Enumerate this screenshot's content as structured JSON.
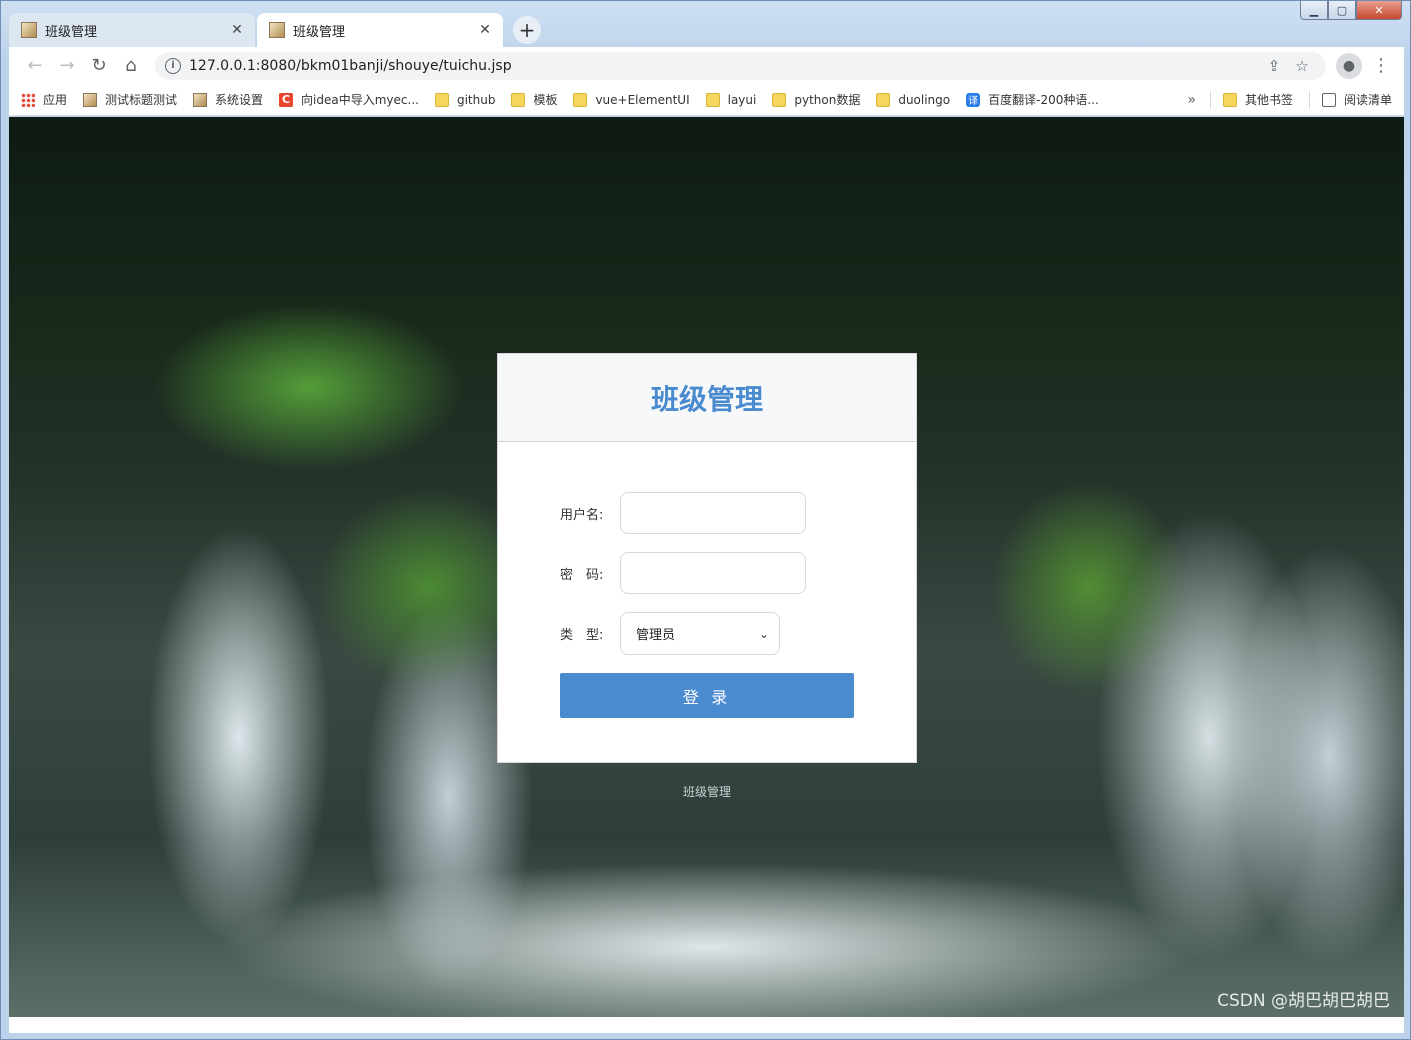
{
  "tabs": [
    {
      "title": "班级管理",
      "active": false
    },
    {
      "title": "班级管理",
      "active": true
    }
  ],
  "toolbar": {
    "url": "127.0.0.1:8080/bkm01banji/shouye/tuichu.jsp"
  },
  "bookmarks": [
    {
      "label": "应用",
      "icon": "apps-grid-icon"
    },
    {
      "label": "测试标题测试",
      "icon": "page-icon"
    },
    {
      "label": "系统设置",
      "icon": "page-icon"
    },
    {
      "label": "向idea中导入myec...",
      "icon": "csdn-icon"
    },
    {
      "label": "github",
      "icon": "folder-icon"
    },
    {
      "label": "模板",
      "icon": "folder-icon"
    },
    {
      "label": "vue+ElementUI",
      "icon": "folder-icon"
    },
    {
      "label": "layui",
      "icon": "folder-icon"
    },
    {
      "label": "python数据",
      "icon": "folder-icon"
    },
    {
      "label": "duolingo",
      "icon": "folder-icon"
    },
    {
      "label": "百度翻译-200种语...",
      "icon": "translate-icon"
    }
  ],
  "bookmarks_right": {
    "more": "»",
    "other": "其他书签",
    "reading": "阅读清单"
  },
  "login": {
    "title": "班级管理",
    "username_label": "用户名:",
    "password_label": "密　码:",
    "type_label": "类　型:",
    "type_selected": "管理员",
    "submit_label": "登 录"
  },
  "footer": "班级管理",
  "watermark": "CSDN @胡巴胡巴胡巴",
  "colors": {
    "accent": "#4a8bd0"
  }
}
